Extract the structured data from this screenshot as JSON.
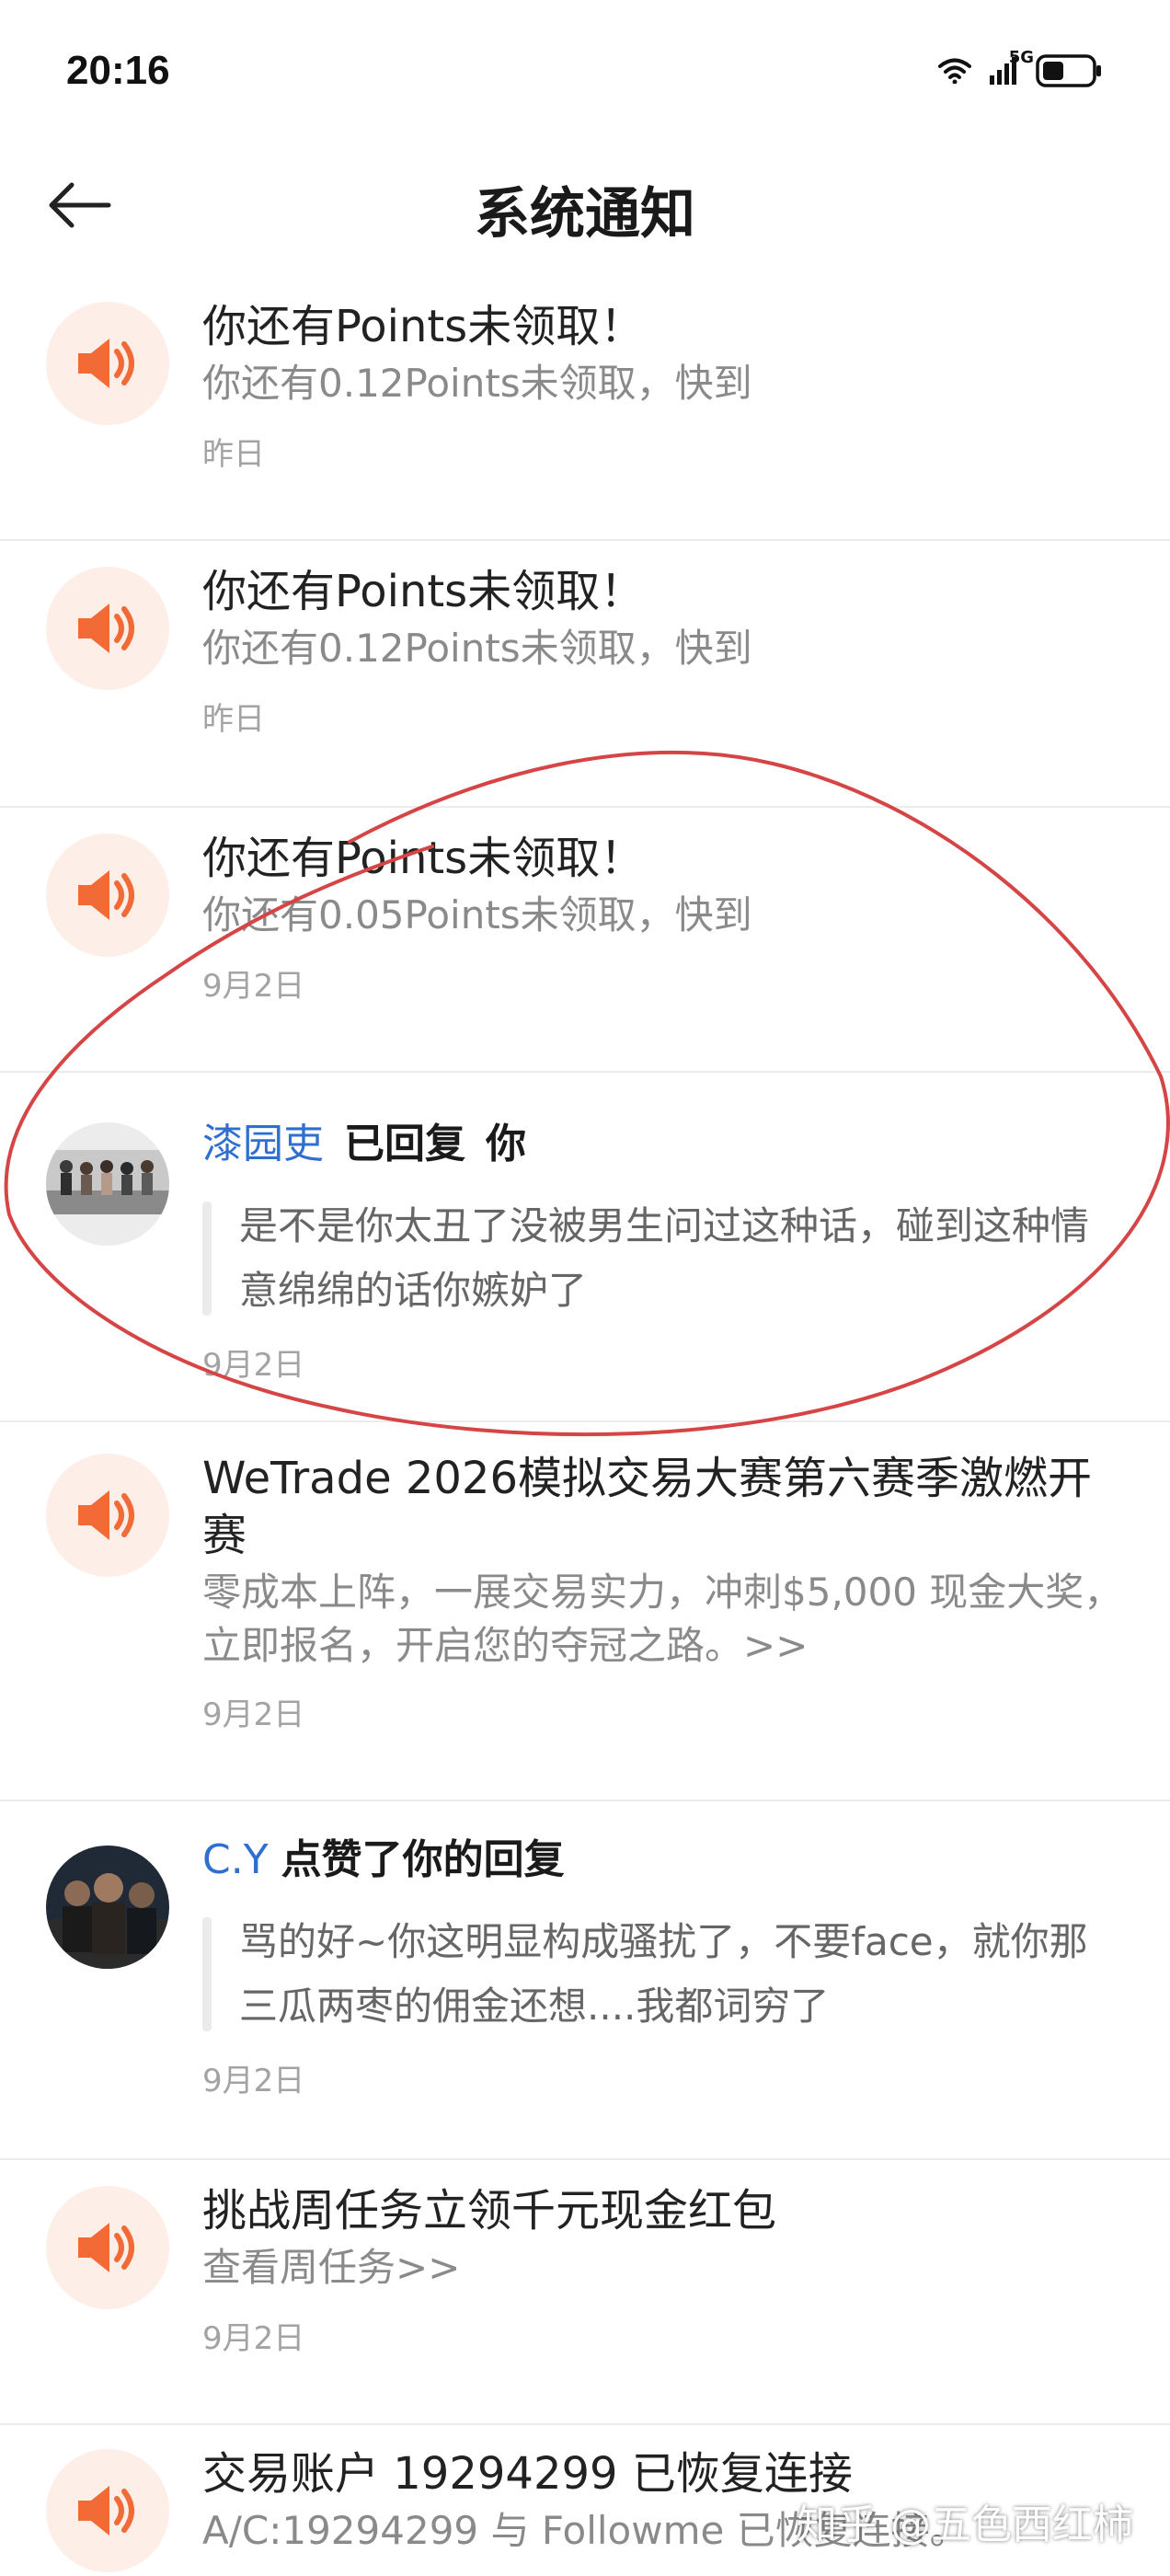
{
  "status_bar": {
    "time": "20:16",
    "network": "5G",
    "icons": [
      "wifi-icon",
      "signal-icon",
      "battery-icon"
    ]
  },
  "header": {
    "title": "系统通知",
    "back_icon": "arrow-left-icon"
  },
  "notifications": [
    {
      "kind": "system",
      "icon": "speaker-icon",
      "title": "你还有Points未领取！",
      "desc": "你还有0.12Points未领取，快到",
      "time": "昨日"
    },
    {
      "kind": "system",
      "icon": "speaker-icon",
      "title": "你还有Points未领取！",
      "desc": "你还有0.12Points未领取，快到",
      "time": "昨日"
    },
    {
      "kind": "system",
      "icon": "speaker-icon",
      "title": "你还有Points未领取！",
      "desc": "你还有0.05Points未领取，快到",
      "time": "9月2日"
    },
    {
      "kind": "reply",
      "user": "漆园吏",
      "action": "已回复",
      "target": "你",
      "quote": "是不是你太丑了没被男生问过这种话，碰到这种情意绵绵的话你嫉妒了",
      "time": "9月2日"
    },
    {
      "kind": "system",
      "icon": "speaker-icon",
      "title": "WeTrade 2026模拟交易大赛第六赛季激燃开赛",
      "desc": "零成本上阵，一展交易实力，冲刺$5,000 现金大奖，立即报名，开启您的夺冠之路。>>",
      "time": "9月2日"
    },
    {
      "kind": "like",
      "user": "C.Y",
      "action": "点赞了你的回复",
      "quote": "骂的好~你这明显构成骚扰了，不要face，就你那三瓜两枣的佣金还想....我都词穷了",
      "time": "9月2日"
    },
    {
      "kind": "system",
      "icon": "speaker-icon",
      "title": "挑战周任务立领千元现金红包",
      "desc": "查看周任务>>",
      "time": "9月2日"
    },
    {
      "kind": "system",
      "icon": "speaker-icon",
      "title": "交易账户 19294299 已恢复连接",
      "desc": "A/C:19294299 与 Followme 已恢复连接。",
      "time": ""
    }
  ],
  "watermark": "知乎 @五色西红柿",
  "colors": {
    "accent_orange": "#f26a36",
    "icon_bg": "#fdeee8",
    "link_blue": "#2f6fd0",
    "annotation_red": "#d64545"
  }
}
